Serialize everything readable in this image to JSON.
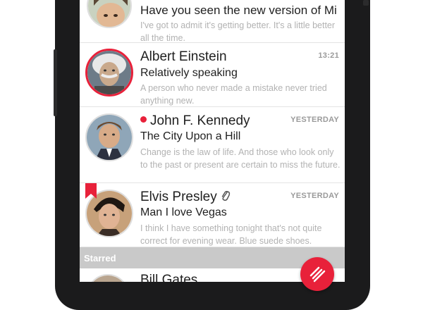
{
  "messages": [
    {
      "sender": "",
      "subject": "Have you seen the new version of Mi",
      "preview": "I've got to admit it's getting better. It's a little better all the time.",
      "time": ""
    },
    {
      "sender": "Albert Einstein",
      "subject": "Relatively speaking",
      "preview": "A person who never made a mistake never tried anything new.",
      "time": "13:21"
    },
    {
      "sender": "John F. Kennedy",
      "subject": "The City Upon a Hill",
      "preview": "Change is the law of life. And those who look only to the past or present are certain to miss the future.",
      "time": "YESTERDAY",
      "unread": true
    },
    {
      "sender": "Elvis Presley",
      "subject": "Man I love Vegas",
      "preview": "I think I have something tonight that's not quite correct for evening wear. Blue suede shoes.",
      "time": "YESTERDAY",
      "has_attachment": true,
      "bookmarked": true
    }
  ],
  "section_header": "Starred",
  "starred": [
    {
      "sender": "Bill Gates"
    }
  ],
  "icons": {
    "attachment": "paperclip-icon",
    "bookmark": "bookmark-icon",
    "fab": "compose-icon"
  },
  "colors": {
    "accent": "#e8213a",
    "section_bg": "#c9c9c9",
    "preview_text": "#b2b2b2"
  }
}
